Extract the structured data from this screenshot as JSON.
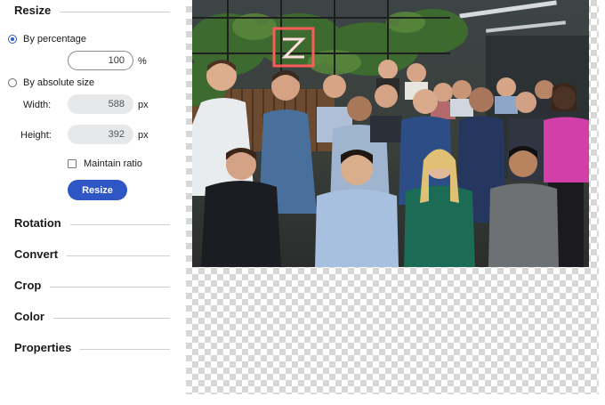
{
  "resize": {
    "title": "Resize",
    "by_percentage_label": "By percentage",
    "percentage_value": "100",
    "percentage_unit": "%",
    "by_absolute_label": "By absolute size",
    "width_label": "Width:",
    "width_value": "588",
    "height_label": "Height:",
    "height_value": "392",
    "px_unit": "px",
    "maintain_ratio_label": "Maintain ratio",
    "resize_button_label": "Resize"
  },
  "sections": {
    "rotation": "Rotation",
    "convert": "Convert",
    "crop": "Crop",
    "color": "Color",
    "properties": "Properties"
  },
  "colors": {
    "accent": "#2e56c4",
    "checker": "#d7d7d7"
  }
}
